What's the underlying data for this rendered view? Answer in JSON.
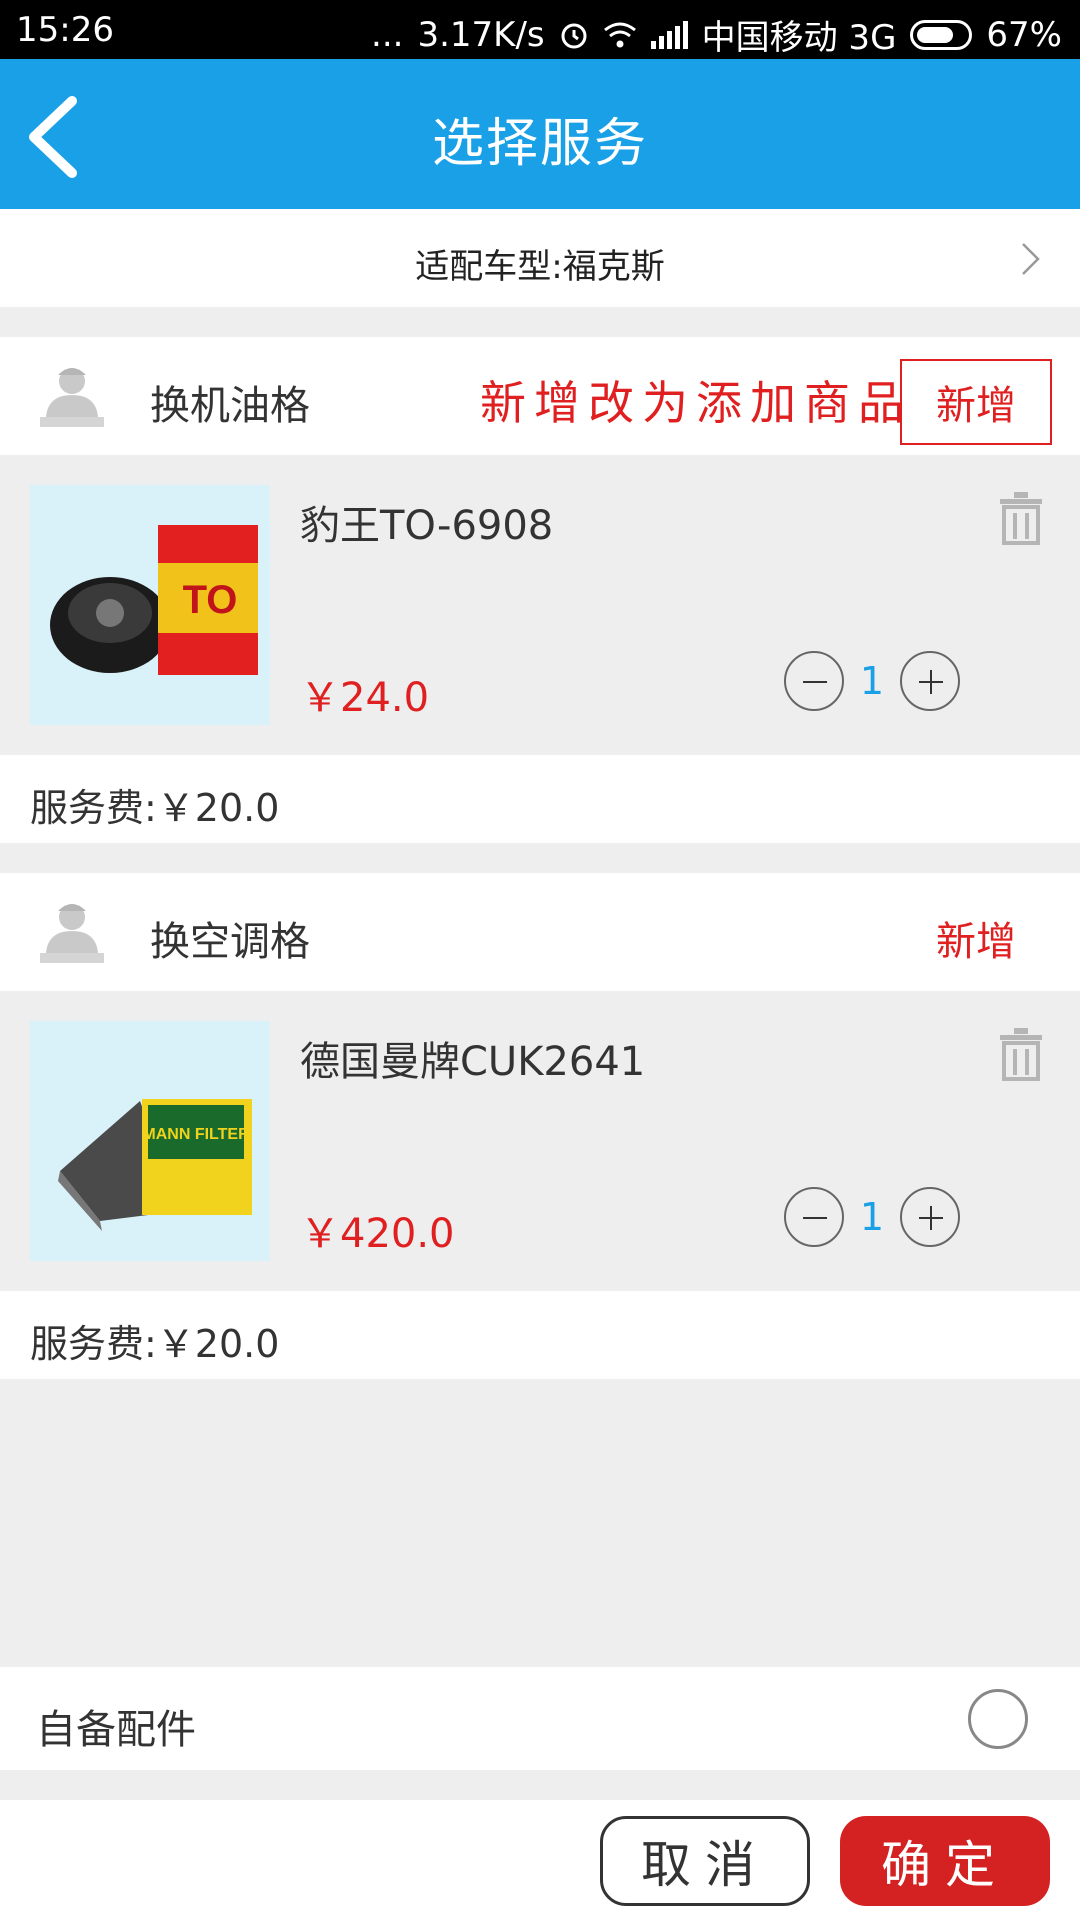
{
  "status_bar": {
    "time": "15:26",
    "dots": "...",
    "speed": "3.17K/s",
    "carrier": "中国移动 3G",
    "battery": "67%",
    "icons": [
      "alarm-icon",
      "wifi-icon",
      "signal-icon",
      "battery-icon"
    ]
  },
  "header": {
    "title": "选择服务",
    "back_icon": "back-arrow-icon"
  },
  "car_model": {
    "label": "适配车型:福克斯",
    "icon": "chevron-right-icon"
  },
  "annotation": "新增改为添加商品",
  "sections": [
    {
      "name": "换机油格",
      "add_label": "新增",
      "item": {
        "name": "豹王TO-6908",
        "price": "￥24.0",
        "qty": "1",
        "thumb_text": "TO"
      },
      "service_fee": "服务费:￥20.0"
    },
    {
      "name": "换空调格",
      "add_label": "新增",
      "item": {
        "name": "德国曼牌CUK2641",
        "price": "￥420.0",
        "qty": "1",
        "thumb_text": "MANN FILTER"
      },
      "service_fee": "服务费:￥20.0"
    }
  ],
  "own_parts": {
    "label": "自备配件"
  },
  "footer": {
    "cancel": "取消",
    "confirm": "确定"
  },
  "colors": {
    "primary": "#1aa0e6",
    "accent_red": "#e02020",
    "confirm_red": "#d42121",
    "background": "#eeeeee"
  }
}
